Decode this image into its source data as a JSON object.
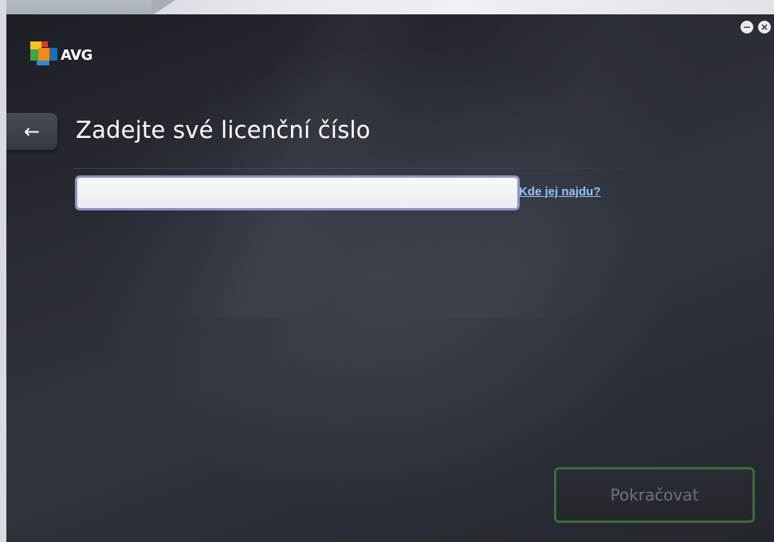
{
  "app": {
    "logo_text": "AVG"
  },
  "window_controls": {
    "minimize_glyph": "−",
    "close_glyph": "×"
  },
  "navigation": {
    "back_glyph": "←"
  },
  "page": {
    "title": "Zadejte své licenční číslo"
  },
  "license_field": {
    "value": "",
    "placeholder": ""
  },
  "help_link": {
    "label": "Kde jej najdu?"
  },
  "footer": {
    "continue_label": "Pokračovat"
  },
  "colors": {
    "background_dark": "#2a2d35",
    "input_border": "#8e92c4",
    "link": "#8fc2ff",
    "continue_border": "#3c6a3c",
    "continue_text_disabled": "#6e737b"
  },
  "icons": {
    "back": "arrow-left-icon",
    "minimize": "minimize-icon",
    "close": "close-icon",
    "logo": "avg-logo-icon"
  }
}
